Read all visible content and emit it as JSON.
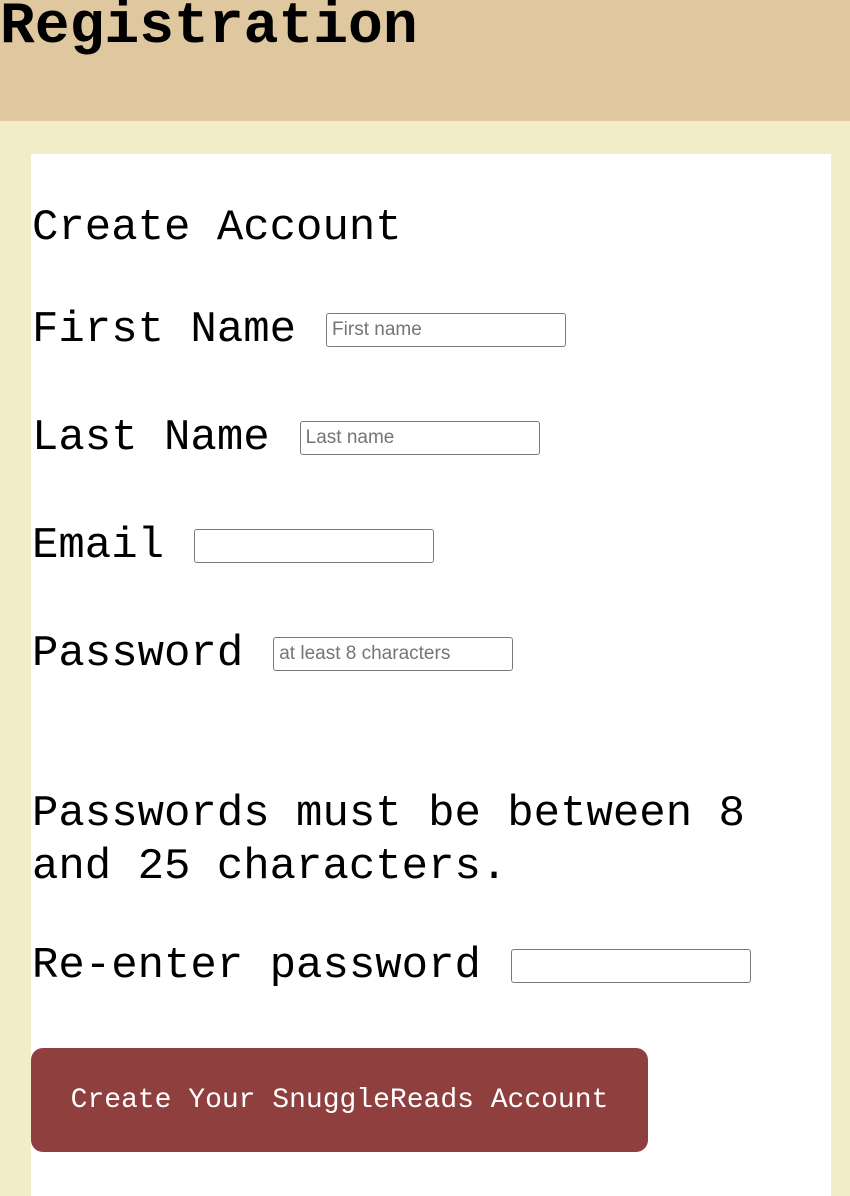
{
  "header": {
    "title": "Registration"
  },
  "form": {
    "heading": "Create Account",
    "first_name": {
      "label": "First Name",
      "placeholder": "First name",
      "value": ""
    },
    "last_name": {
      "label": "Last Name",
      "placeholder": "Last name",
      "value": ""
    },
    "email": {
      "label": "Email",
      "placeholder": "",
      "value": ""
    },
    "password": {
      "label": "Password",
      "placeholder": "at least 8 characters",
      "value": ""
    },
    "password_note": "Passwords must be between 8 and 25 characters.",
    "confirm_password": {
      "label": "Re-enter password",
      "placeholder": "",
      "value": ""
    },
    "submit_label": "Create Your SnuggleReads Account"
  },
  "colors": {
    "header_background": "#dfc8a0",
    "page_background": "#f2ecc8",
    "panel_background": "#ffffff",
    "button_background": "#8f403e",
    "button_text": "#ffffff"
  }
}
